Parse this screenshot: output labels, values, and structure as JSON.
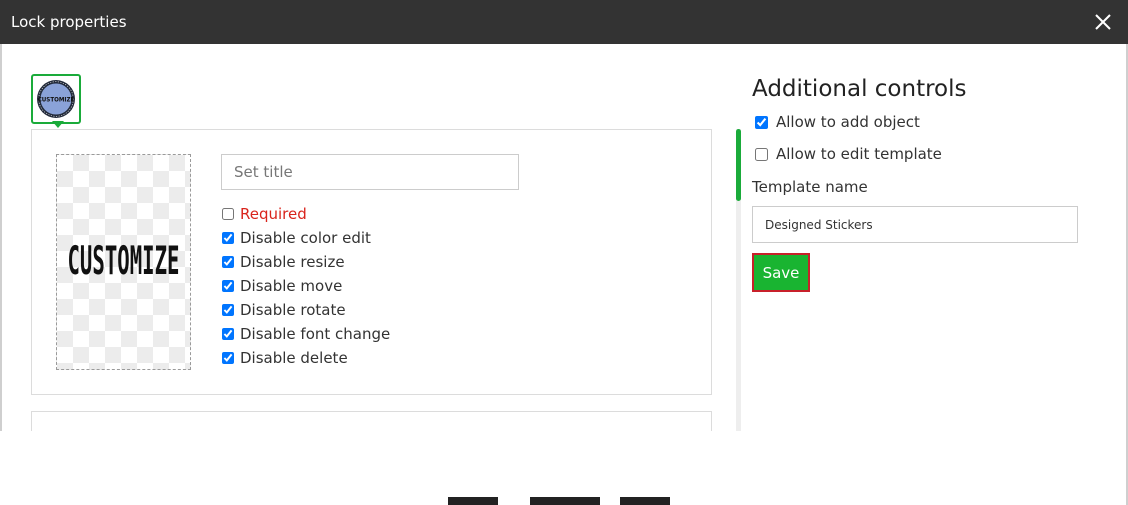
{
  "window": {
    "title": "Lock properties"
  },
  "layer": {
    "thumbnail_text": "CUSTOMIZE",
    "preview_text": "CUSTOMIZE",
    "title_placeholder": "Set title",
    "title_value": "",
    "checks": [
      {
        "label": "Required",
        "checked": false
      },
      {
        "label": "Disable color edit",
        "checked": true
      },
      {
        "label": "Disable resize",
        "checked": true
      },
      {
        "label": "Disable move",
        "checked": true
      },
      {
        "label": "Disable rotate",
        "checked": true
      },
      {
        "label": "Disable font change",
        "checked": true
      },
      {
        "label": "Disable delete",
        "checked": true
      }
    ]
  },
  "additional": {
    "title": "Additional controls",
    "allow_add_object": {
      "label": "Allow to add object",
      "checked": true
    },
    "allow_edit_template": {
      "label": "Allow to edit template",
      "checked": false
    },
    "template_name_label": "Template name",
    "template_name_value": "Designed Stickers",
    "save_label": "Save"
  },
  "colors": {
    "titlebar": "#333333",
    "accent_green": "#1aab3a",
    "save_button": "#19b431",
    "save_border": "#c8202a",
    "required_red": "#d9241c"
  },
  "icons": {
    "close": "close-icon",
    "thumbnail": "customize-badge-icon"
  }
}
